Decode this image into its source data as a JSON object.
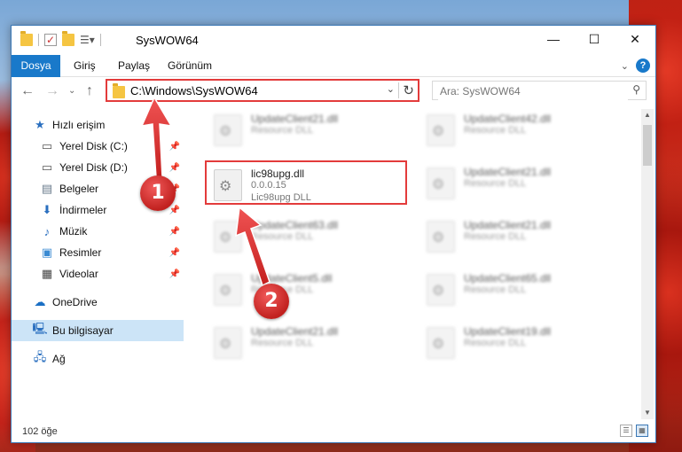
{
  "window": {
    "title": "SysWOW64"
  },
  "titlebar": {
    "minimize": "—",
    "maximize": "☐",
    "close": "✕"
  },
  "ribbon": {
    "tabs": [
      "Dosya",
      "Giriş",
      "Paylaş",
      "Görünüm"
    ]
  },
  "navbar": {
    "path": "C:\\Windows\\SysWOW64",
    "search_placeholder": "Ara: SysWOW64"
  },
  "sidebar": {
    "items": [
      {
        "label": "Hızlı erişim",
        "icon": "star-icon",
        "pinned": false
      },
      {
        "label": "Yerel Disk (C:)",
        "icon": "drive-icon",
        "pinned": true
      },
      {
        "label": "Yerel Disk (D:)",
        "icon": "drive-icon",
        "pinned": true
      },
      {
        "label": "Belgeler",
        "icon": "document-icon",
        "pinned": true
      },
      {
        "label": "İndirmeler",
        "icon": "download-icon",
        "pinned": true
      },
      {
        "label": "Müzik",
        "icon": "music-icon",
        "pinned": true
      },
      {
        "label": "Resimler",
        "icon": "pictures-icon",
        "pinned": true
      },
      {
        "label": "Videolar",
        "icon": "video-icon",
        "pinned": true
      },
      {
        "label": "OneDrive",
        "icon": "cloud-icon",
        "pinned": false
      },
      {
        "label": "Bu bilgisayar",
        "icon": "computer-icon",
        "pinned": false
      },
      {
        "label": "Ağ",
        "icon": "network-icon",
        "pinned": false
      }
    ]
  },
  "files": {
    "left": [
      {
        "name": "UpdateClient21.dll",
        "line2": "Resource DLL",
        "line3": ""
      },
      {
        "name": "lic98upg.dll",
        "line2": "0.0.0.15",
        "line3": "Lic98upg DLL"
      },
      {
        "name": "UpdateClient63.dll",
        "line2": "Resource DLL",
        "line3": ""
      },
      {
        "name": "UpdateClient5.dll",
        "line2": "Resource DLL",
        "line3": ""
      },
      {
        "name": "UpdateClient21.dll",
        "line2": "Resource DLL",
        "line3": ""
      }
    ],
    "right": [
      {
        "name": "UpdateClient42.dll",
        "line2": "Resource DLL"
      },
      {
        "name": "UpdateClient21.dll",
        "line2": "Resource DLL"
      },
      {
        "name": "UpdateClient21.dll",
        "line2": "Resource DLL"
      },
      {
        "name": "UpdateClient65.dll",
        "line2": "Resource DLL"
      },
      {
        "name": "UpdateClient19.dll",
        "line2": "Resource DLL"
      }
    ]
  },
  "status": {
    "count": "102 öğe"
  },
  "annotations": {
    "marker1": "1",
    "marker2": "2",
    "color": "#e33b3b"
  }
}
